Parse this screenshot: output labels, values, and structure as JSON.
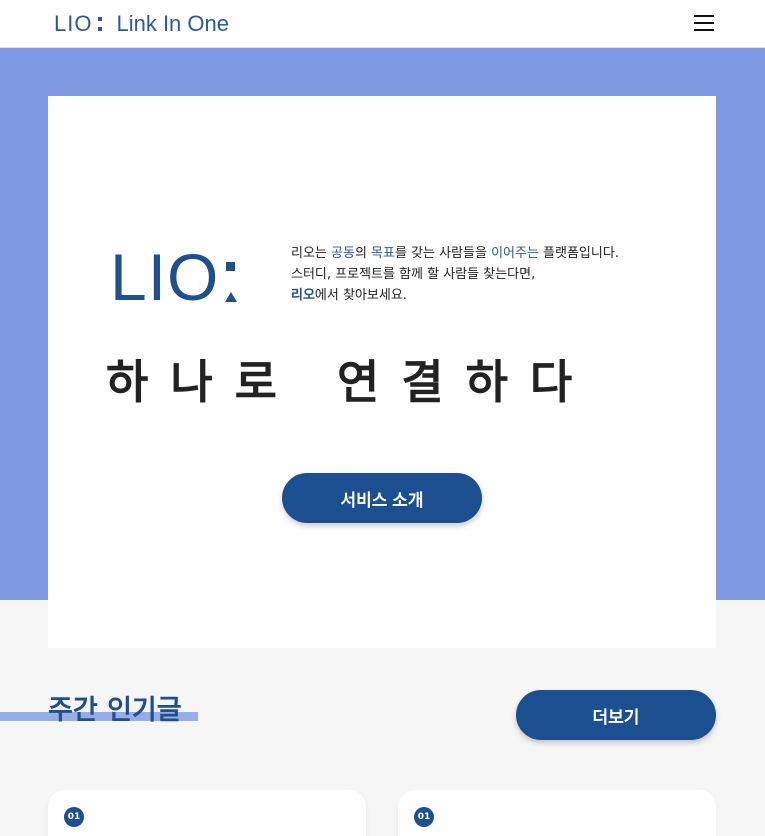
{
  "navbar": {
    "brand_abbr": "LIO",
    "brand_name": "Link In One",
    "menu_icon": "hamburger-menu-icon"
  },
  "hero": {
    "logo_text": "LIO",
    "intro_line1_a": "리오는 ",
    "intro_line1_hl1": "공동",
    "intro_line1_b": "의 ",
    "intro_line1_hl2": "목표",
    "intro_line1_c": "를 갖는 사람들을 ",
    "intro_line1_hl3": "이어주는",
    "intro_line1_d": " 플랫폼입니다.",
    "intro_line2": "스터디, 프로젝트를 함께 할 사람들 찾는다면,",
    "intro_line3_bold": "리오",
    "intro_line3_rest": "에서 찾아보세요.",
    "tagline": "하나로 연결하다",
    "service_button": "서비스 소개"
  },
  "popular": {
    "title": "주간 인기글",
    "more_button": "더보기",
    "cards": [
      {
        "rank": "01"
      },
      {
        "rank": "01"
      }
    ]
  },
  "colors": {
    "primary": "#1c4f8f",
    "accent_band": "#7e99e2",
    "underline": "#98acea",
    "background": "#f6f6f6"
  }
}
